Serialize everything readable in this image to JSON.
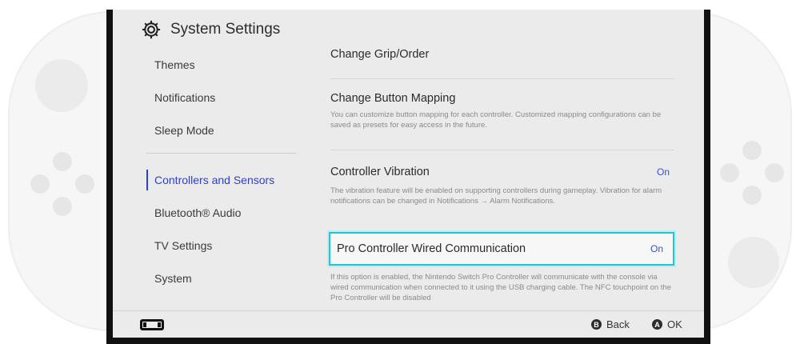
{
  "header": {
    "title": "System Settings",
    "icon": "gear-icon"
  },
  "sidebar": {
    "items": [
      {
        "label": "Themes"
      },
      {
        "label": "Notifications"
      },
      {
        "label": "Sleep Mode"
      },
      {
        "label": "Controllers and Sensors",
        "active": true
      },
      {
        "label": "Bluetooth® Audio"
      },
      {
        "label": "TV Settings"
      },
      {
        "label": "System"
      }
    ]
  },
  "content": {
    "grip_order": {
      "title": "Change Grip/Order"
    },
    "button_mapping": {
      "title": "Change Button Mapping",
      "desc": "You can customize button mapping for each controller. Customized mapping configurations can be saved as presets for easy access in the future."
    },
    "vibration": {
      "title": "Controller Vibration",
      "value": "On",
      "desc": "The vibration feature will be enabled on supporting controllers during gameplay. Vibration for alarm notifications can be changed in Notifications → Alarm Notifications."
    },
    "pro_wired": {
      "title": "Pro Controller Wired Communication",
      "value": "On",
      "desc": "If this option is enabled, the Nintendo Switch Pro Controller will communicate with the console via wired communication when connected to it using the USB charging cable. The NFC touchpoint on the Pro Controller will be disabled"
    }
  },
  "footer": {
    "back": {
      "button": "B",
      "label": "Back"
    },
    "ok": {
      "button": "A",
      "label": "OK"
    },
    "left_icon": "controller-icon"
  },
  "colors": {
    "accent_blue": "#2d3fd0",
    "highlight_cyan": "#23c5d2",
    "screen_bg": "#ebebeb"
  }
}
